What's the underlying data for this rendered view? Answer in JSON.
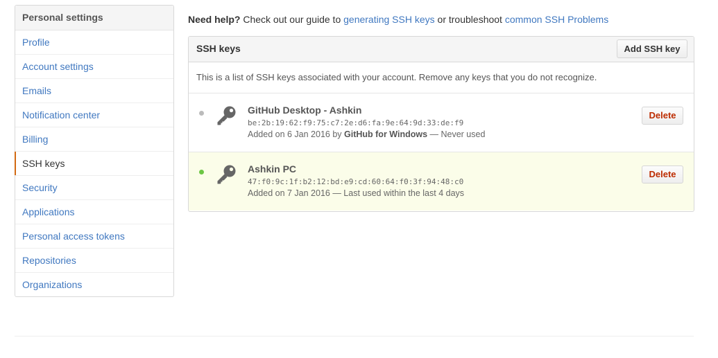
{
  "sidebar": {
    "header": "Personal settings",
    "items": [
      {
        "label": "Profile"
      },
      {
        "label": "Account settings"
      },
      {
        "label": "Emails"
      },
      {
        "label": "Notification center"
      },
      {
        "label": "Billing"
      },
      {
        "label": "SSH keys",
        "selected": true
      },
      {
        "label": "Security"
      },
      {
        "label": "Applications"
      },
      {
        "label": "Personal access tokens"
      },
      {
        "label": "Repositories"
      },
      {
        "label": "Organizations"
      }
    ]
  },
  "help": {
    "lead": "Need help?",
    "text1": " Check out our guide to ",
    "link1": "generating SSH keys",
    "text2": " or troubleshoot ",
    "link2": "common SSH Problems"
  },
  "panel": {
    "title": "SSH keys",
    "add_button": "Add SSH key",
    "description": "This is a list of SSH keys associated with your account. Remove any keys that you do not recognize.",
    "keys": [
      {
        "title": "GitHub Desktop - Ashkin",
        "fingerprint": "be:2b:19:62:f9:75:c7:2e:d6:fa:9e:64:9d:33:de:f9",
        "added_prefix": "Added on 6 Jan 2016 by ",
        "added_by": "GitHub for Windows",
        "usage": " — Never used",
        "status_color": "#bbbbbb",
        "delete_label": "Delete"
      },
      {
        "title": "Ashkin PC",
        "fingerprint": "47:f0:9c:1f:b2:12:bd:e9:cd:60:64:f0:3f:94:48:c0",
        "added_prefix": "Added on 7 Jan 2016",
        "added_by": "",
        "usage": " — Last used within the last 4 days",
        "status_color": "#6cc644",
        "delete_label": "Delete"
      }
    ]
  },
  "colors": {
    "link": "#4078c0",
    "selected_accent": "#d26911",
    "danger": "#bd2c00",
    "recent_bg": "#fbfde9"
  }
}
